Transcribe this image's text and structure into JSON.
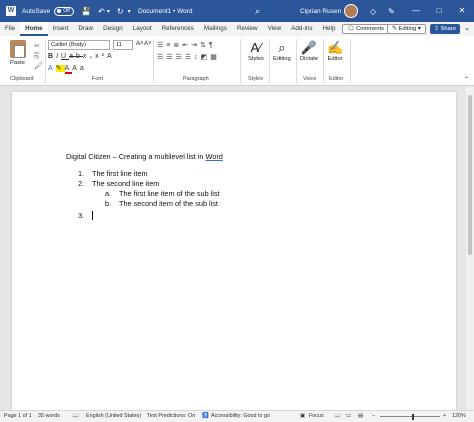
{
  "titlebar": {
    "autosave_label": "AutoSave",
    "autosave_state": "Off",
    "doc_title": "Document1 • Word",
    "user_name": "Ciprian Rusen",
    "minimize": "—",
    "maximize": "□",
    "close": "✕"
  },
  "menu": {
    "tabs": [
      "File",
      "Home",
      "Insert",
      "Draw",
      "Design",
      "Layout",
      "References",
      "Mailings",
      "Review",
      "View",
      "Add-ins",
      "Help"
    ],
    "active_tab": "Home",
    "comments_label": "Comments",
    "editing_label": "Editing",
    "share_label": "Share"
  },
  "ribbon": {
    "paste_label": "Paste",
    "font_name": "Calibri (Body)",
    "font_size": "11",
    "groups": {
      "clipboard": "Clipboard",
      "font": "Font",
      "paragraph": "Paragraph",
      "styles": "Styles",
      "voice": "Voice",
      "editor": "Editor"
    },
    "styles_label": "Styles",
    "editing_btn_label": "Editing",
    "dictate_label": "Dictate",
    "editor_label": "Editor"
  },
  "document": {
    "heading_prefix": "Digital Citizen – Creating a multilevel list in ",
    "heading_word": "Word",
    "list": [
      {
        "marker": "1.",
        "text": "The first line item"
      },
      {
        "marker": "2.",
        "text": "The second line item"
      },
      {
        "marker": "a.",
        "text": "The first line item of the sub list"
      },
      {
        "marker": "b.",
        "text": "The second item of the sub list"
      },
      {
        "marker": "3.",
        "text": ""
      }
    ]
  },
  "status": {
    "page": "Page 1 of 1",
    "words": "35 words",
    "language": "English (United States)",
    "predictions": "Text Predictions: On",
    "accessibility": "Accessibility: Good to go",
    "focus": "Focus",
    "zoom": "120%"
  }
}
